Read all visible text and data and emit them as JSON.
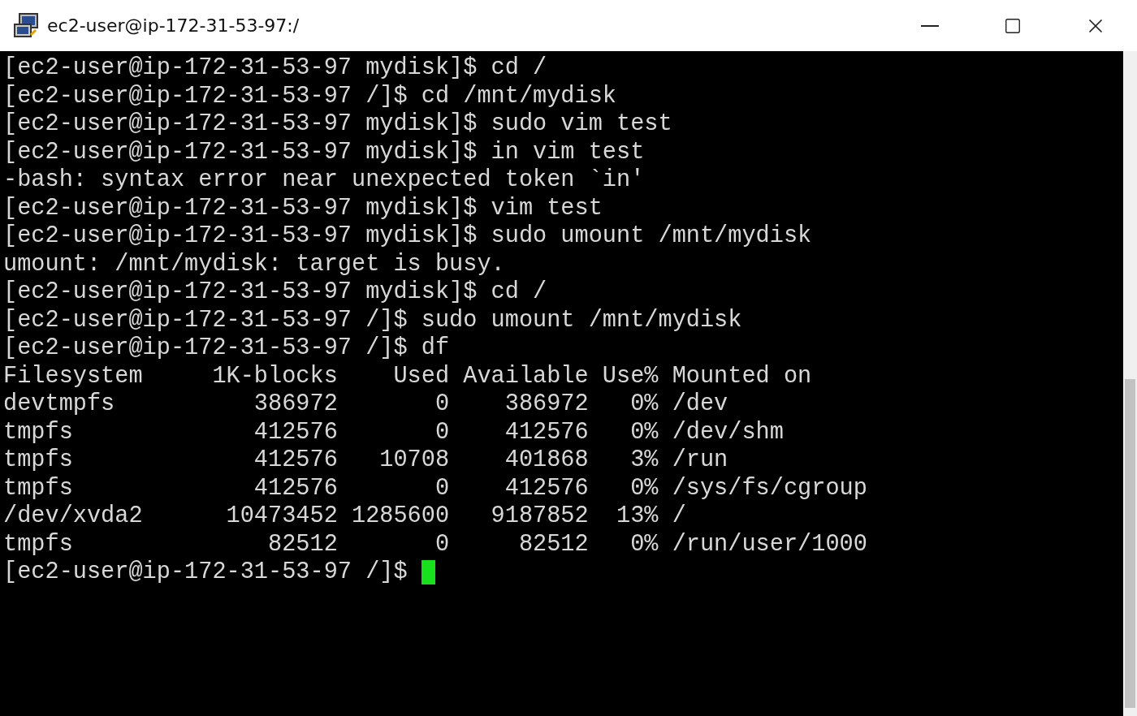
{
  "window": {
    "title": "ec2-user@ip-172-31-53-97:/"
  },
  "terminal": {
    "lines": [
      "[ec2-user@ip-172-31-53-97 mydisk]$ cd /",
      "[ec2-user@ip-172-31-53-97 /]$ cd /mnt/mydisk",
      "[ec2-user@ip-172-31-53-97 mydisk]$ sudo vim test",
      "[ec2-user@ip-172-31-53-97 mydisk]$ in vim test",
      "-bash: syntax error near unexpected token `in'",
      "[ec2-user@ip-172-31-53-97 mydisk]$ vim test",
      "[ec2-user@ip-172-31-53-97 mydisk]$ sudo umount /mnt/mydisk",
      "umount: /mnt/mydisk: target is busy.",
      "[ec2-user@ip-172-31-53-97 mydisk]$ cd /",
      "[ec2-user@ip-172-31-53-97 /]$ sudo umount /mnt/mydisk",
      "[ec2-user@ip-172-31-53-97 /]$ df",
      "Filesystem     1K-blocks    Used Available Use% Mounted on",
      "devtmpfs          386972       0    386972   0% /dev",
      "tmpfs             412576       0    412576   0% /dev/shm",
      "tmpfs             412576   10708    401868   3% /run",
      "tmpfs             412576       0    412576   0% /sys/fs/cgroup",
      "/dev/xvda2      10473452 1285600   9187852  13% /",
      "tmpfs              82512       0     82512   0% /run/user/1000"
    ],
    "prompt": "[ec2-user@ip-172-31-53-97 /]$"
  }
}
